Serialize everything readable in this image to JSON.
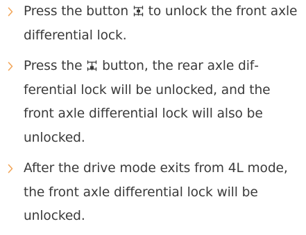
{
  "items": [
    {
      "before": "Press the button ",
      "icon": "front-axle-diff-lock-icon",
      "after": " to unlock the front axle differential lock."
    },
    {
      "before": "Press the ",
      "icon": "rear-axle-diff-lock-icon",
      "after": " button, the rear axle dif­ferential lock will be unlocked, and the front axle differential lock will also be unlocked."
    },
    {
      "before": "After the drive mode exits from 4L mode, the front axle differential lock will be unlocked."
    }
  ],
  "colors": {
    "text": "#3a3a3a",
    "bullet": "#f2a65a"
  }
}
